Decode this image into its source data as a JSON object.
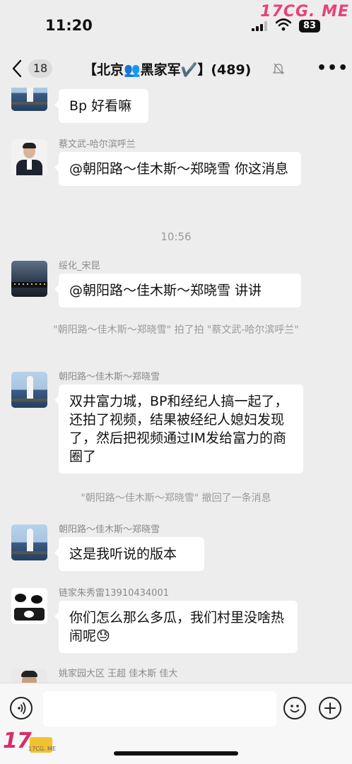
{
  "status_bar": {
    "time": "11:20",
    "battery": "83",
    "watermark": "17CG. ME"
  },
  "nav": {
    "back_count": "18",
    "title": "【北京👥黑家军✔️】(489)"
  },
  "messages": [
    {
      "text": "Bp 好看嘛"
    },
    {
      "sender": "蔡文武-哈尔滨呼兰",
      "text": "@朝阳路～佳木斯～郑晓雪 你这消息"
    },
    {
      "time": "10:56"
    },
    {
      "sender": "绥化_宋昆",
      "text": "@朝阳路～佳木斯～郑晓雪 讲讲"
    },
    {
      "system": "\"朝阳路～佳木斯～郑晓雪\" 拍了拍 \"蔡文武-哈尔滨呼兰\""
    },
    {
      "sender": "朝阳路～佳木斯～郑晓雪",
      "text": "双井富力城，BP和经纪人搞一起了，还拍了视频，结果被经纪人媳妇发现了，然后把视频通过IM发给富力的商圈了"
    },
    {
      "system": "\"朝阳路～佳木斯～郑晓雪\" 撤回了一条消息"
    },
    {
      "sender": "朝阳路～佳木斯～郑晓雪",
      "text": "这是我听说的版本"
    },
    {
      "sender": "链家朱秀雷13910434001",
      "text": "你们怎么那么多瓜，我们村里没啥热闹呢😓"
    },
    {
      "sender": "姚家园大区 王超 佳木斯 佳大"
    }
  ],
  "watermark_bottom": {
    "brand": "17",
    "site": "17CG. ME"
  }
}
